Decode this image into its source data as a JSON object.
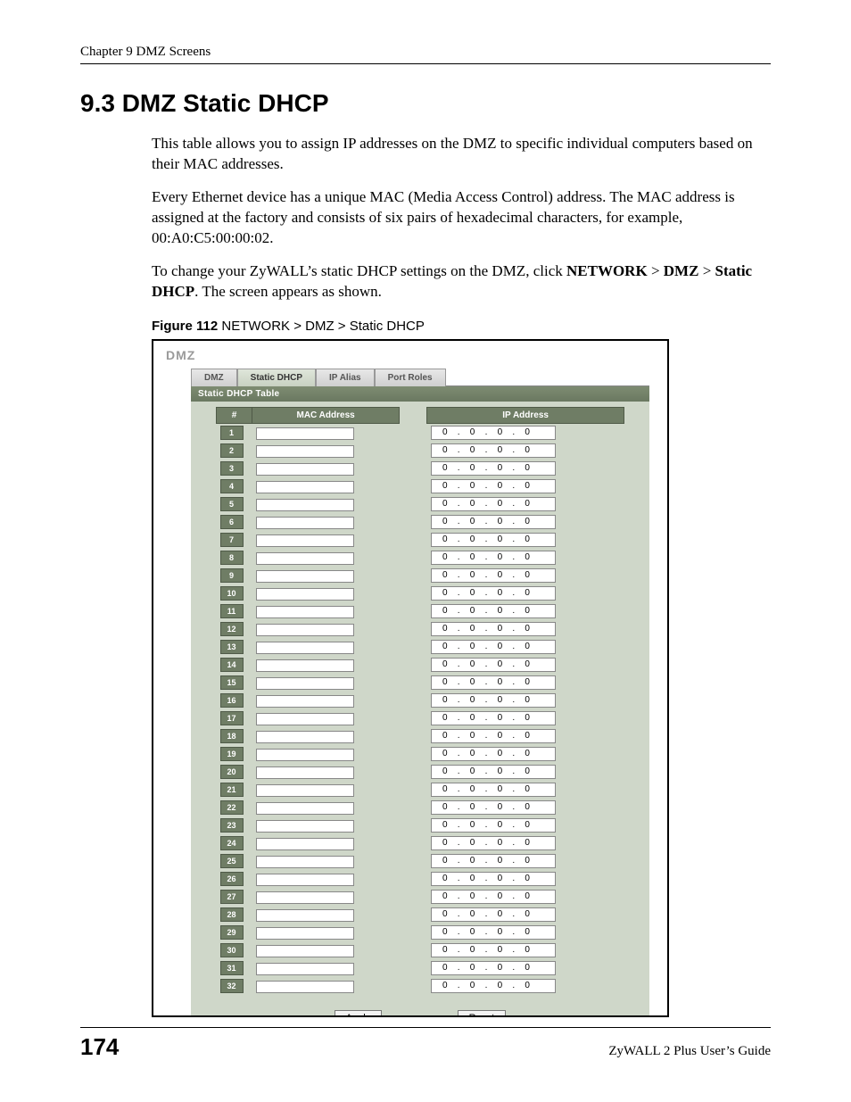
{
  "header": {
    "chapter": "Chapter 9 DMZ Screens"
  },
  "section": {
    "number_title": "9.3  DMZ Static DHCP"
  },
  "paragraphs": {
    "p1": "This table allows you to assign IP addresses on the DMZ to specific individual computers based on their MAC addresses.",
    "p2": "Every Ethernet device has a unique MAC (Media Access Control) address. The MAC address is assigned at the factory and consists of six pairs of hexadecimal characters, for example, 00:A0:C5:00:00:02.",
    "p3a": "To change your ZyWALL’s static DHCP settings on the DMZ, click ",
    "p3b": "NETWORK",
    "p3c": " > ",
    "p3d": "DMZ",
    "p3e": " > ",
    "p3f": "Static DHCP",
    "p3g": ". The screen appears as shown."
  },
  "figure": {
    "label": "Figure 112",
    "caption": "   NETWORK > DMZ > Static DHCP"
  },
  "screenshot": {
    "title": "DMZ",
    "tabs": {
      "t1": "DMZ",
      "t2": "Static DHCP",
      "t3": "IP Alias",
      "t4": "Port Roles"
    },
    "table_title": "Static DHCP Table",
    "columns": {
      "num": "#",
      "mac": "MAC Address",
      "ip": "IP Address"
    },
    "rows": [
      {
        "n": "1",
        "mac": "",
        "ip": [
          "0",
          "0",
          "0",
          "0"
        ]
      },
      {
        "n": "2",
        "mac": "",
        "ip": [
          "0",
          "0",
          "0",
          "0"
        ]
      },
      {
        "n": "3",
        "mac": "",
        "ip": [
          "0",
          "0",
          "0",
          "0"
        ]
      },
      {
        "n": "4",
        "mac": "",
        "ip": [
          "0",
          "0",
          "0",
          "0"
        ]
      },
      {
        "n": "5",
        "mac": "",
        "ip": [
          "0",
          "0",
          "0",
          "0"
        ]
      },
      {
        "n": "6",
        "mac": "",
        "ip": [
          "0",
          "0",
          "0",
          "0"
        ]
      },
      {
        "n": "7",
        "mac": "",
        "ip": [
          "0",
          "0",
          "0",
          "0"
        ]
      },
      {
        "n": "8",
        "mac": "",
        "ip": [
          "0",
          "0",
          "0",
          "0"
        ]
      },
      {
        "n": "9",
        "mac": "",
        "ip": [
          "0",
          "0",
          "0",
          "0"
        ]
      },
      {
        "n": "10",
        "mac": "",
        "ip": [
          "0",
          "0",
          "0",
          "0"
        ]
      },
      {
        "n": "11",
        "mac": "",
        "ip": [
          "0",
          "0",
          "0",
          "0"
        ]
      },
      {
        "n": "12",
        "mac": "",
        "ip": [
          "0",
          "0",
          "0",
          "0"
        ]
      },
      {
        "n": "13",
        "mac": "",
        "ip": [
          "0",
          "0",
          "0",
          "0"
        ]
      },
      {
        "n": "14",
        "mac": "",
        "ip": [
          "0",
          "0",
          "0",
          "0"
        ]
      },
      {
        "n": "15",
        "mac": "",
        "ip": [
          "0",
          "0",
          "0",
          "0"
        ]
      },
      {
        "n": "16",
        "mac": "",
        "ip": [
          "0",
          "0",
          "0",
          "0"
        ]
      },
      {
        "n": "17",
        "mac": "",
        "ip": [
          "0",
          "0",
          "0",
          "0"
        ]
      },
      {
        "n": "18",
        "mac": "",
        "ip": [
          "0",
          "0",
          "0",
          "0"
        ]
      },
      {
        "n": "19",
        "mac": "",
        "ip": [
          "0",
          "0",
          "0",
          "0"
        ]
      },
      {
        "n": "20",
        "mac": "",
        "ip": [
          "0",
          "0",
          "0",
          "0"
        ]
      },
      {
        "n": "21",
        "mac": "",
        "ip": [
          "0",
          "0",
          "0",
          "0"
        ]
      },
      {
        "n": "22",
        "mac": "",
        "ip": [
          "0",
          "0",
          "0",
          "0"
        ]
      },
      {
        "n": "23",
        "mac": "",
        "ip": [
          "0",
          "0",
          "0",
          "0"
        ]
      },
      {
        "n": "24",
        "mac": "",
        "ip": [
          "0",
          "0",
          "0",
          "0"
        ]
      },
      {
        "n": "25",
        "mac": "",
        "ip": [
          "0",
          "0",
          "0",
          "0"
        ]
      },
      {
        "n": "26",
        "mac": "",
        "ip": [
          "0",
          "0",
          "0",
          "0"
        ]
      },
      {
        "n": "27",
        "mac": "",
        "ip": [
          "0",
          "0",
          "0",
          "0"
        ]
      },
      {
        "n": "28",
        "mac": "",
        "ip": [
          "0",
          "0",
          "0",
          "0"
        ]
      },
      {
        "n": "29",
        "mac": "",
        "ip": [
          "0",
          "0",
          "0",
          "0"
        ]
      },
      {
        "n": "30",
        "mac": "",
        "ip": [
          "0",
          "0",
          "0",
          "0"
        ]
      },
      {
        "n": "31",
        "mac": "",
        "ip": [
          "0",
          "0",
          "0",
          "0"
        ]
      },
      {
        "n": "32",
        "mac": "",
        "ip": [
          "0",
          "0",
          "0",
          "0"
        ]
      }
    ],
    "buttons": {
      "apply": "Apply",
      "reset": "Reset"
    }
  },
  "footer": {
    "page": "174",
    "guide": "ZyWALL 2 Plus User’s Guide"
  }
}
